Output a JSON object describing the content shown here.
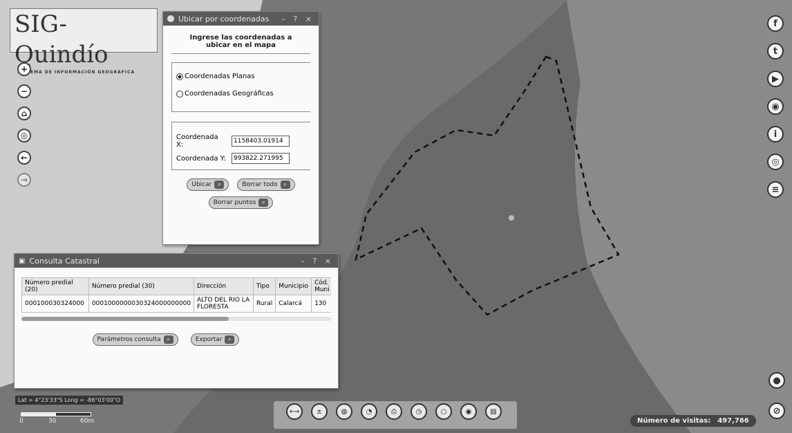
{
  "logo": {
    "title": "SIG-Quindío",
    "subtitle": "SISTEMA DE INFORMACIÓN GEOGRÁFICA"
  },
  "map_tools": [
    {
      "name": "zoom-in-button",
      "glyph": "+"
    },
    {
      "name": "zoom-out-button",
      "glyph": "−"
    },
    {
      "name": "home-button",
      "glyph": "⌂"
    },
    {
      "name": "locate-button",
      "glyph": "◎"
    },
    {
      "name": "back-button",
      "glyph": "←"
    },
    {
      "name": "forward-button",
      "glyph": "→"
    }
  ],
  "social": [
    {
      "name": "facebook-icon",
      "glyph": "f"
    },
    {
      "name": "twitter-icon",
      "glyph": "t"
    },
    {
      "name": "youtube-icon",
      "glyph": "▶"
    },
    {
      "name": "network-icon",
      "glyph": "◉"
    },
    {
      "name": "info-icon",
      "glyph": "i"
    },
    {
      "name": "layers-icon",
      "glyph": "◎"
    },
    {
      "name": "list-icon",
      "glyph": "≡"
    }
  ],
  "locate_dialog": {
    "title": "Ubicar por coordenadas",
    "controls": "– ? ×",
    "heading": "Ingrese las coordenadas a ubicar en el mapa",
    "option_planas": "Coordenadas Planas",
    "option_geograficas": "Coordenadas Geográficas",
    "x_label": "Coordenada X:",
    "x_value": "1158403.01914",
    "y_label": "Coordenada Y:",
    "y_value": "993822.271995",
    "ubicar_label": "Ubicar",
    "borrar_todo_label": "Borrar todo",
    "borrar_puntos_label": "Borrar puntos"
  },
  "cadastral": {
    "title": "Consulta Catastral",
    "controls": "– ? ×",
    "headers": [
      "Número predial (20)",
      "Número predial (30)",
      "Dirección",
      "Tipo",
      "Municipio",
      "Cód. Muni"
    ],
    "row": [
      "000100030324000",
      "0001000000030324000000000",
      "ALTO DEL RIO LA FLORESTA",
      "Rural",
      "Calarcá",
      "130"
    ],
    "params_label": "Parámetros consulta",
    "export_label": "Exportar"
  },
  "coords_readout": "Lat = 4°23'33\"S Long = -86°03'00\"O",
  "scale": {
    "ticks": [
      "0",
      "30",
      "60m"
    ]
  },
  "visits": {
    "label": "Número de visitas:",
    "value": "497,766"
  },
  "bottom_tools": [
    "ruler-icon",
    "calculator-icon",
    "globe-icon",
    "map-icon",
    "print-icon",
    "clock-icon",
    "camera-icon",
    "share-icon",
    "document-icon"
  ],
  "colors": {
    "map_dark": "#6f6f6f",
    "map_light": "#c9c9c9",
    "panel_title": "#5a5a5a"
  }
}
